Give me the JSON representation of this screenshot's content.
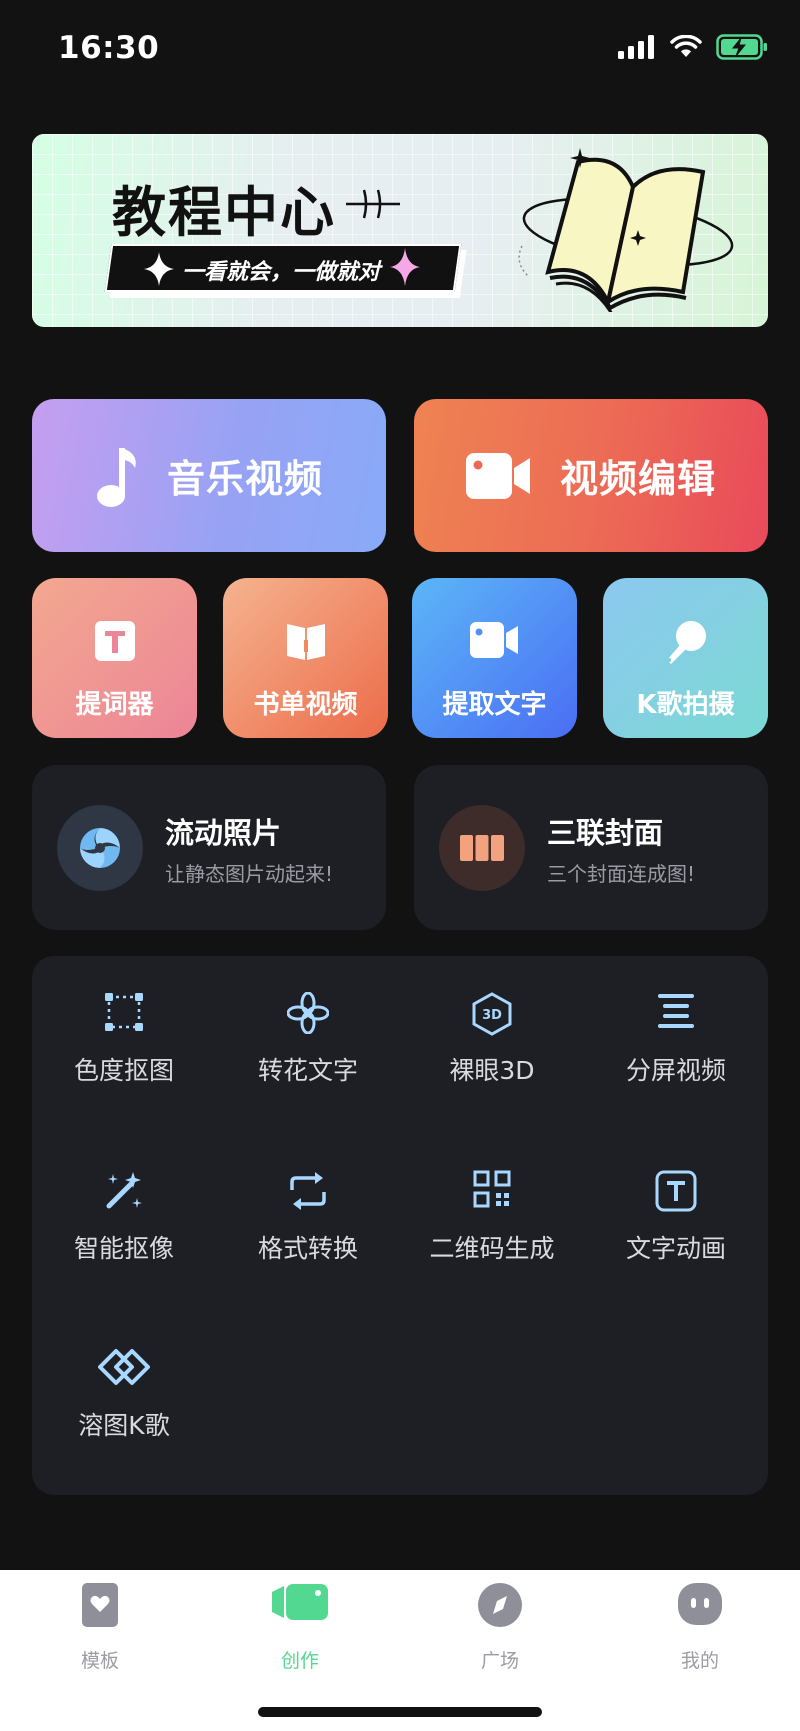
{
  "status": {
    "time": "16:30"
  },
  "banner": {
    "title": "教程中心",
    "subtitle": "一看就会，一做就对"
  },
  "main_actions": [
    {
      "label": "音乐视频",
      "icon": "music-note-icon"
    },
    {
      "label": "视频编辑",
      "icon": "video-camera-icon"
    }
  ],
  "quick_tiles": [
    {
      "label": "提词器",
      "icon": "text-t-icon"
    },
    {
      "label": "书单视频",
      "icon": "book-icon"
    },
    {
      "label": "提取文字",
      "icon": "camera-icon"
    },
    {
      "label": "K歌拍摄",
      "icon": "microphone-icon"
    }
  ],
  "feature_cards": [
    {
      "title": "流动照片",
      "subtitle": "让静态图片动起来!",
      "icon": "swirl-icon"
    },
    {
      "title": "三联封面",
      "subtitle": "三个封面连成图!",
      "icon": "triptych-icon"
    }
  ],
  "tools": [
    {
      "label": "色度抠图",
      "icon": "crop-frame-icon"
    },
    {
      "label": "转花文字",
      "icon": "flower-text-icon"
    },
    {
      "label": "裸眼3D",
      "icon": "hexagon-3d-icon"
    },
    {
      "label": "分屏视频",
      "icon": "split-lines-icon"
    },
    {
      "label": "智能抠像",
      "icon": "magic-wand-icon"
    },
    {
      "label": "格式转换",
      "icon": "convert-loop-icon"
    },
    {
      "label": "二维码生成",
      "icon": "qr-code-icon"
    },
    {
      "label": "文字动画",
      "icon": "text-box-icon"
    },
    {
      "label": "溶图K歌",
      "icon": "blend-diamond-icon"
    }
  ],
  "tabbar": [
    {
      "label": "模板",
      "icon": "template-heart-icon",
      "active": false
    },
    {
      "label": "创作",
      "icon": "create-camera-icon",
      "active": true
    },
    {
      "label": "广场",
      "icon": "compass-icon",
      "active": false
    },
    {
      "label": "我的",
      "icon": "profile-face-icon",
      "active": false
    }
  ],
  "colors": {
    "accent_green": "#52d890",
    "tool_icon_blue": "#a8d8ff",
    "background": "#121212",
    "card": "#1e1f25"
  }
}
